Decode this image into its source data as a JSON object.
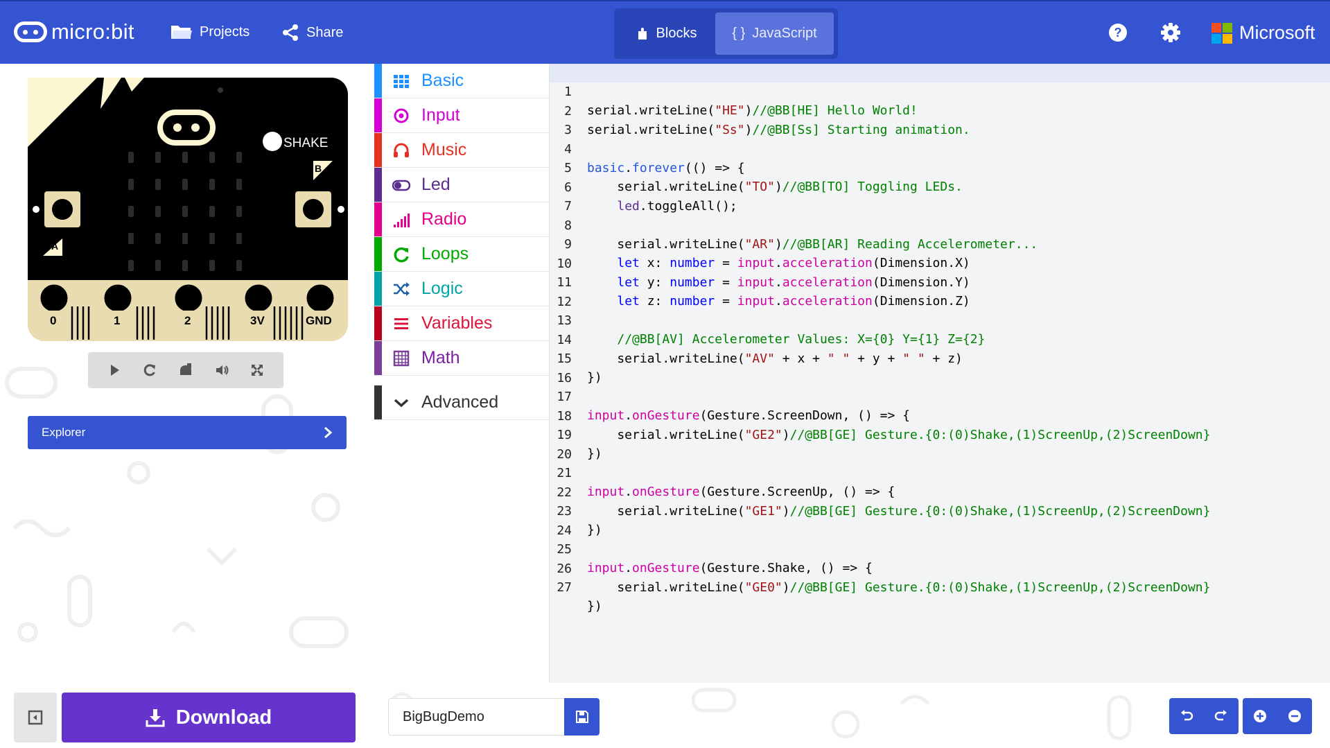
{
  "header": {
    "logo_text": "micro:bit",
    "projects_label": "Projects",
    "share_label": "Share",
    "blocks_label": "Blocks",
    "javascript_label": "JavaScript",
    "javascript_prefix": "{ }",
    "microsoft_label": "Microsoft",
    "colors": {
      "bar": "#3454d1",
      "toggle_active": "#5a72dc"
    }
  },
  "simulator": {
    "shake_label": "SHAKE",
    "button_a": "A",
    "button_b": "B",
    "pins": [
      "0",
      "1",
      "2",
      "3V",
      "GND"
    ],
    "controls": [
      "play-icon",
      "restart-icon",
      "mute-icon",
      "audio-icon",
      "fullscreen-icon"
    ],
    "explorer_label": "Explorer"
  },
  "toolbox": {
    "categories": [
      {
        "label": "Basic",
        "color": "#1e90ff",
        "icon": "grid-icon"
      },
      {
        "label": "Input",
        "color": "#d400d4",
        "icon": "target-icon"
      },
      {
        "label": "Music",
        "color": "#e63022",
        "icon": "headphones-icon"
      },
      {
        "label": "Led",
        "color": "#5c2d91",
        "icon": "toggle-icon"
      },
      {
        "label": "Radio",
        "color": "#e3008c",
        "icon": "signal-icon"
      },
      {
        "label": "Loops",
        "color": "#00aa00",
        "icon": "refresh-icon"
      },
      {
        "label": "Logic",
        "color": "#00a4a6",
        "icon": "shuffle-icon"
      },
      {
        "label": "Variables",
        "color": "#dc143c",
        "icon": "list-icon"
      },
      {
        "label": "Math",
        "color": "#9400d3",
        "icon": "calculator-icon"
      }
    ],
    "advanced_label": "Advanced"
  },
  "editor": {
    "line_numbers": [
      "1",
      "2",
      "3",
      "4",
      "5",
      "6",
      "7",
      "8",
      "9",
      "10",
      "11",
      "12",
      "13",
      "14",
      "15",
      "16",
      "17",
      "18",
      "19",
      "20",
      "21",
      "22",
      "23",
      "24",
      "25",
      "26",
      "27"
    ]
  },
  "bottom": {
    "download_label": "Download",
    "project_name": "BigBugDemo"
  }
}
